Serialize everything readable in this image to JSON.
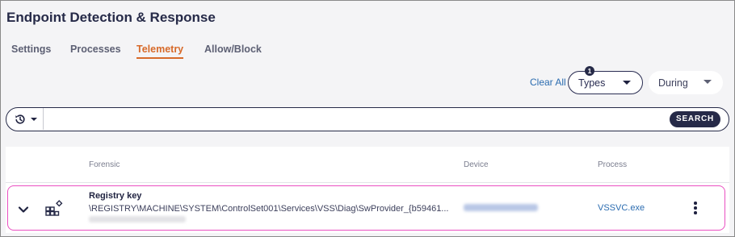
{
  "app": {
    "title": "Endpoint Detection & Response"
  },
  "tabs": [
    {
      "label": "Settings",
      "active": false
    },
    {
      "label": "Processes",
      "active": false
    },
    {
      "label": "Telemetry",
      "active": true
    },
    {
      "label": "Allow/Block",
      "active": false
    }
  ],
  "filters": {
    "clear_all": "Clear All",
    "types": {
      "label": "Types",
      "badge": "1"
    },
    "during": {
      "label": "During"
    }
  },
  "search": {
    "value": "",
    "placeholder": "",
    "button": "SEARCH",
    "history_icon": "history-icon"
  },
  "table": {
    "columns": [
      "Forensic",
      "Device",
      "Process"
    ],
    "rows": [
      {
        "icon": "registry-icon",
        "forensic_title": "Registry key",
        "forensic_path": "\\REGISTRY\\MACHINE\\SYSTEM\\ControlSet001\\Services\\VSS\\Diag\\SwProvider_{b59461...",
        "process": "VSSVC.exe"
      }
    ]
  },
  "colors": {
    "accent": "#d76a2a",
    "primary": "#262a48",
    "link": "#2b6cb0",
    "row_highlight": "#ea4fc2"
  }
}
